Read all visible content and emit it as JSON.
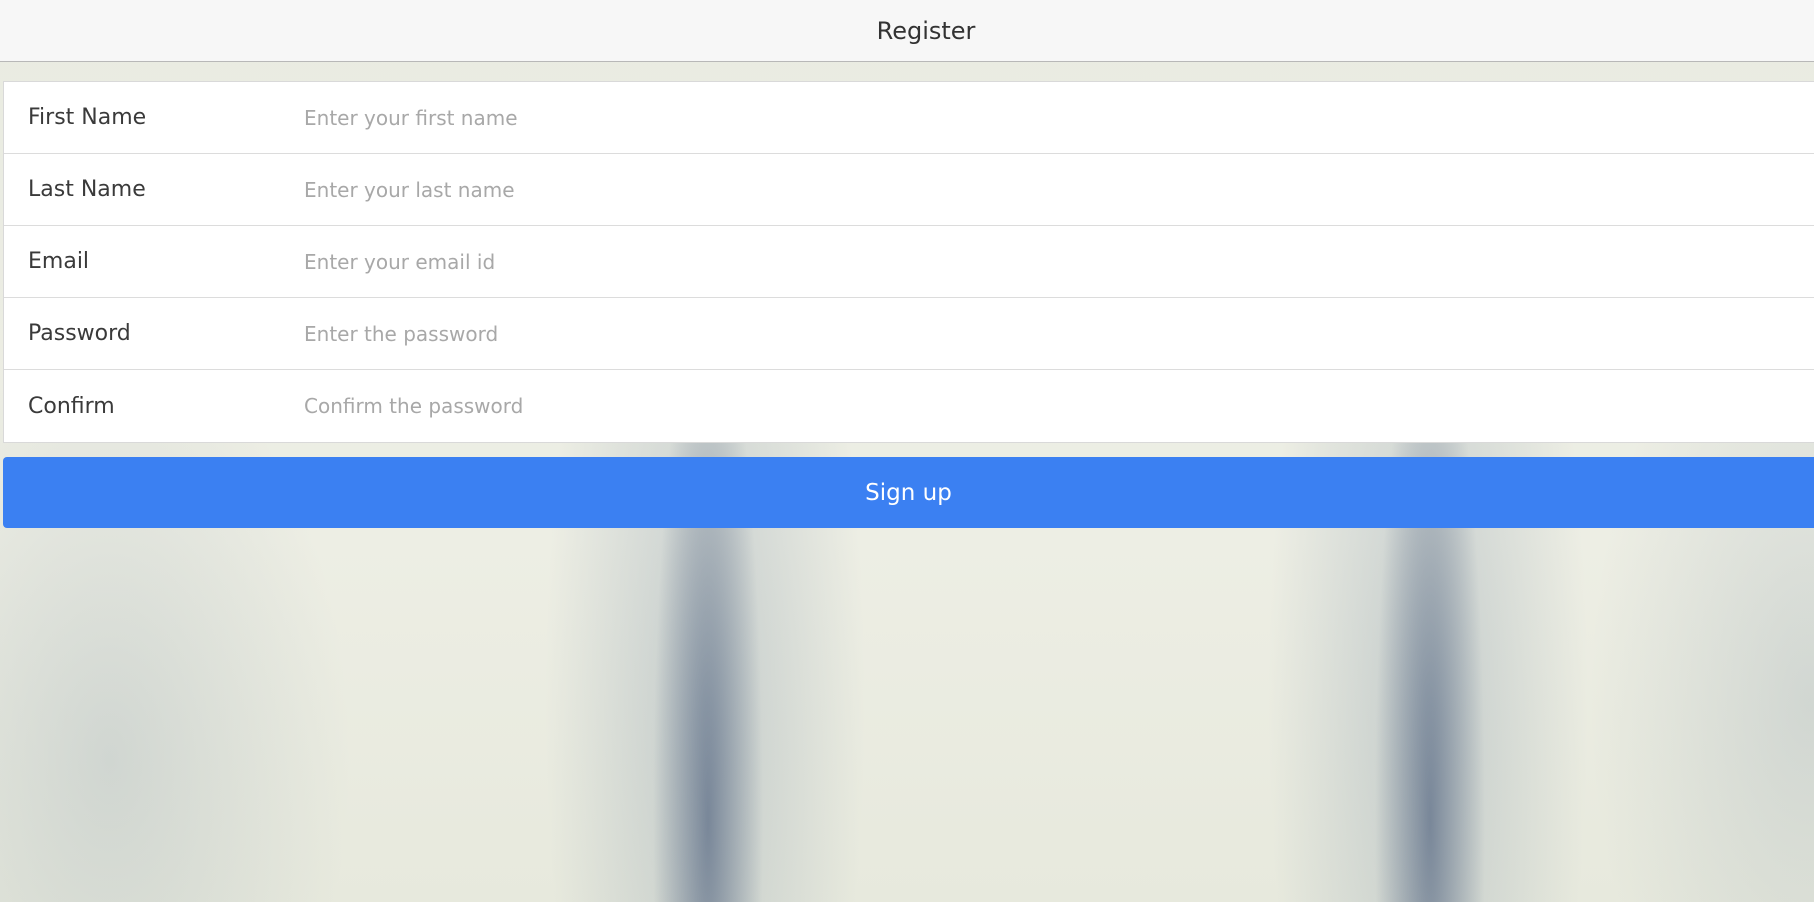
{
  "header": {
    "title": "Register"
  },
  "form": {
    "fields": [
      {
        "label": "First Name",
        "placeholder": "Enter your first name",
        "value": ""
      },
      {
        "label": "Last Name",
        "placeholder": "Enter your last name",
        "value": ""
      },
      {
        "label": "Email",
        "placeholder": "Enter your email id",
        "value": ""
      },
      {
        "label": "Password",
        "placeholder": "Enter the password",
        "value": ""
      },
      {
        "label": "Confirm",
        "placeholder": "Confirm the password",
        "value": ""
      }
    ],
    "submit_label": "Sign up"
  },
  "colors": {
    "accent": "#3b80f2",
    "navbar_bg": "#f7f7f7",
    "form_bg": "#ffffff"
  }
}
